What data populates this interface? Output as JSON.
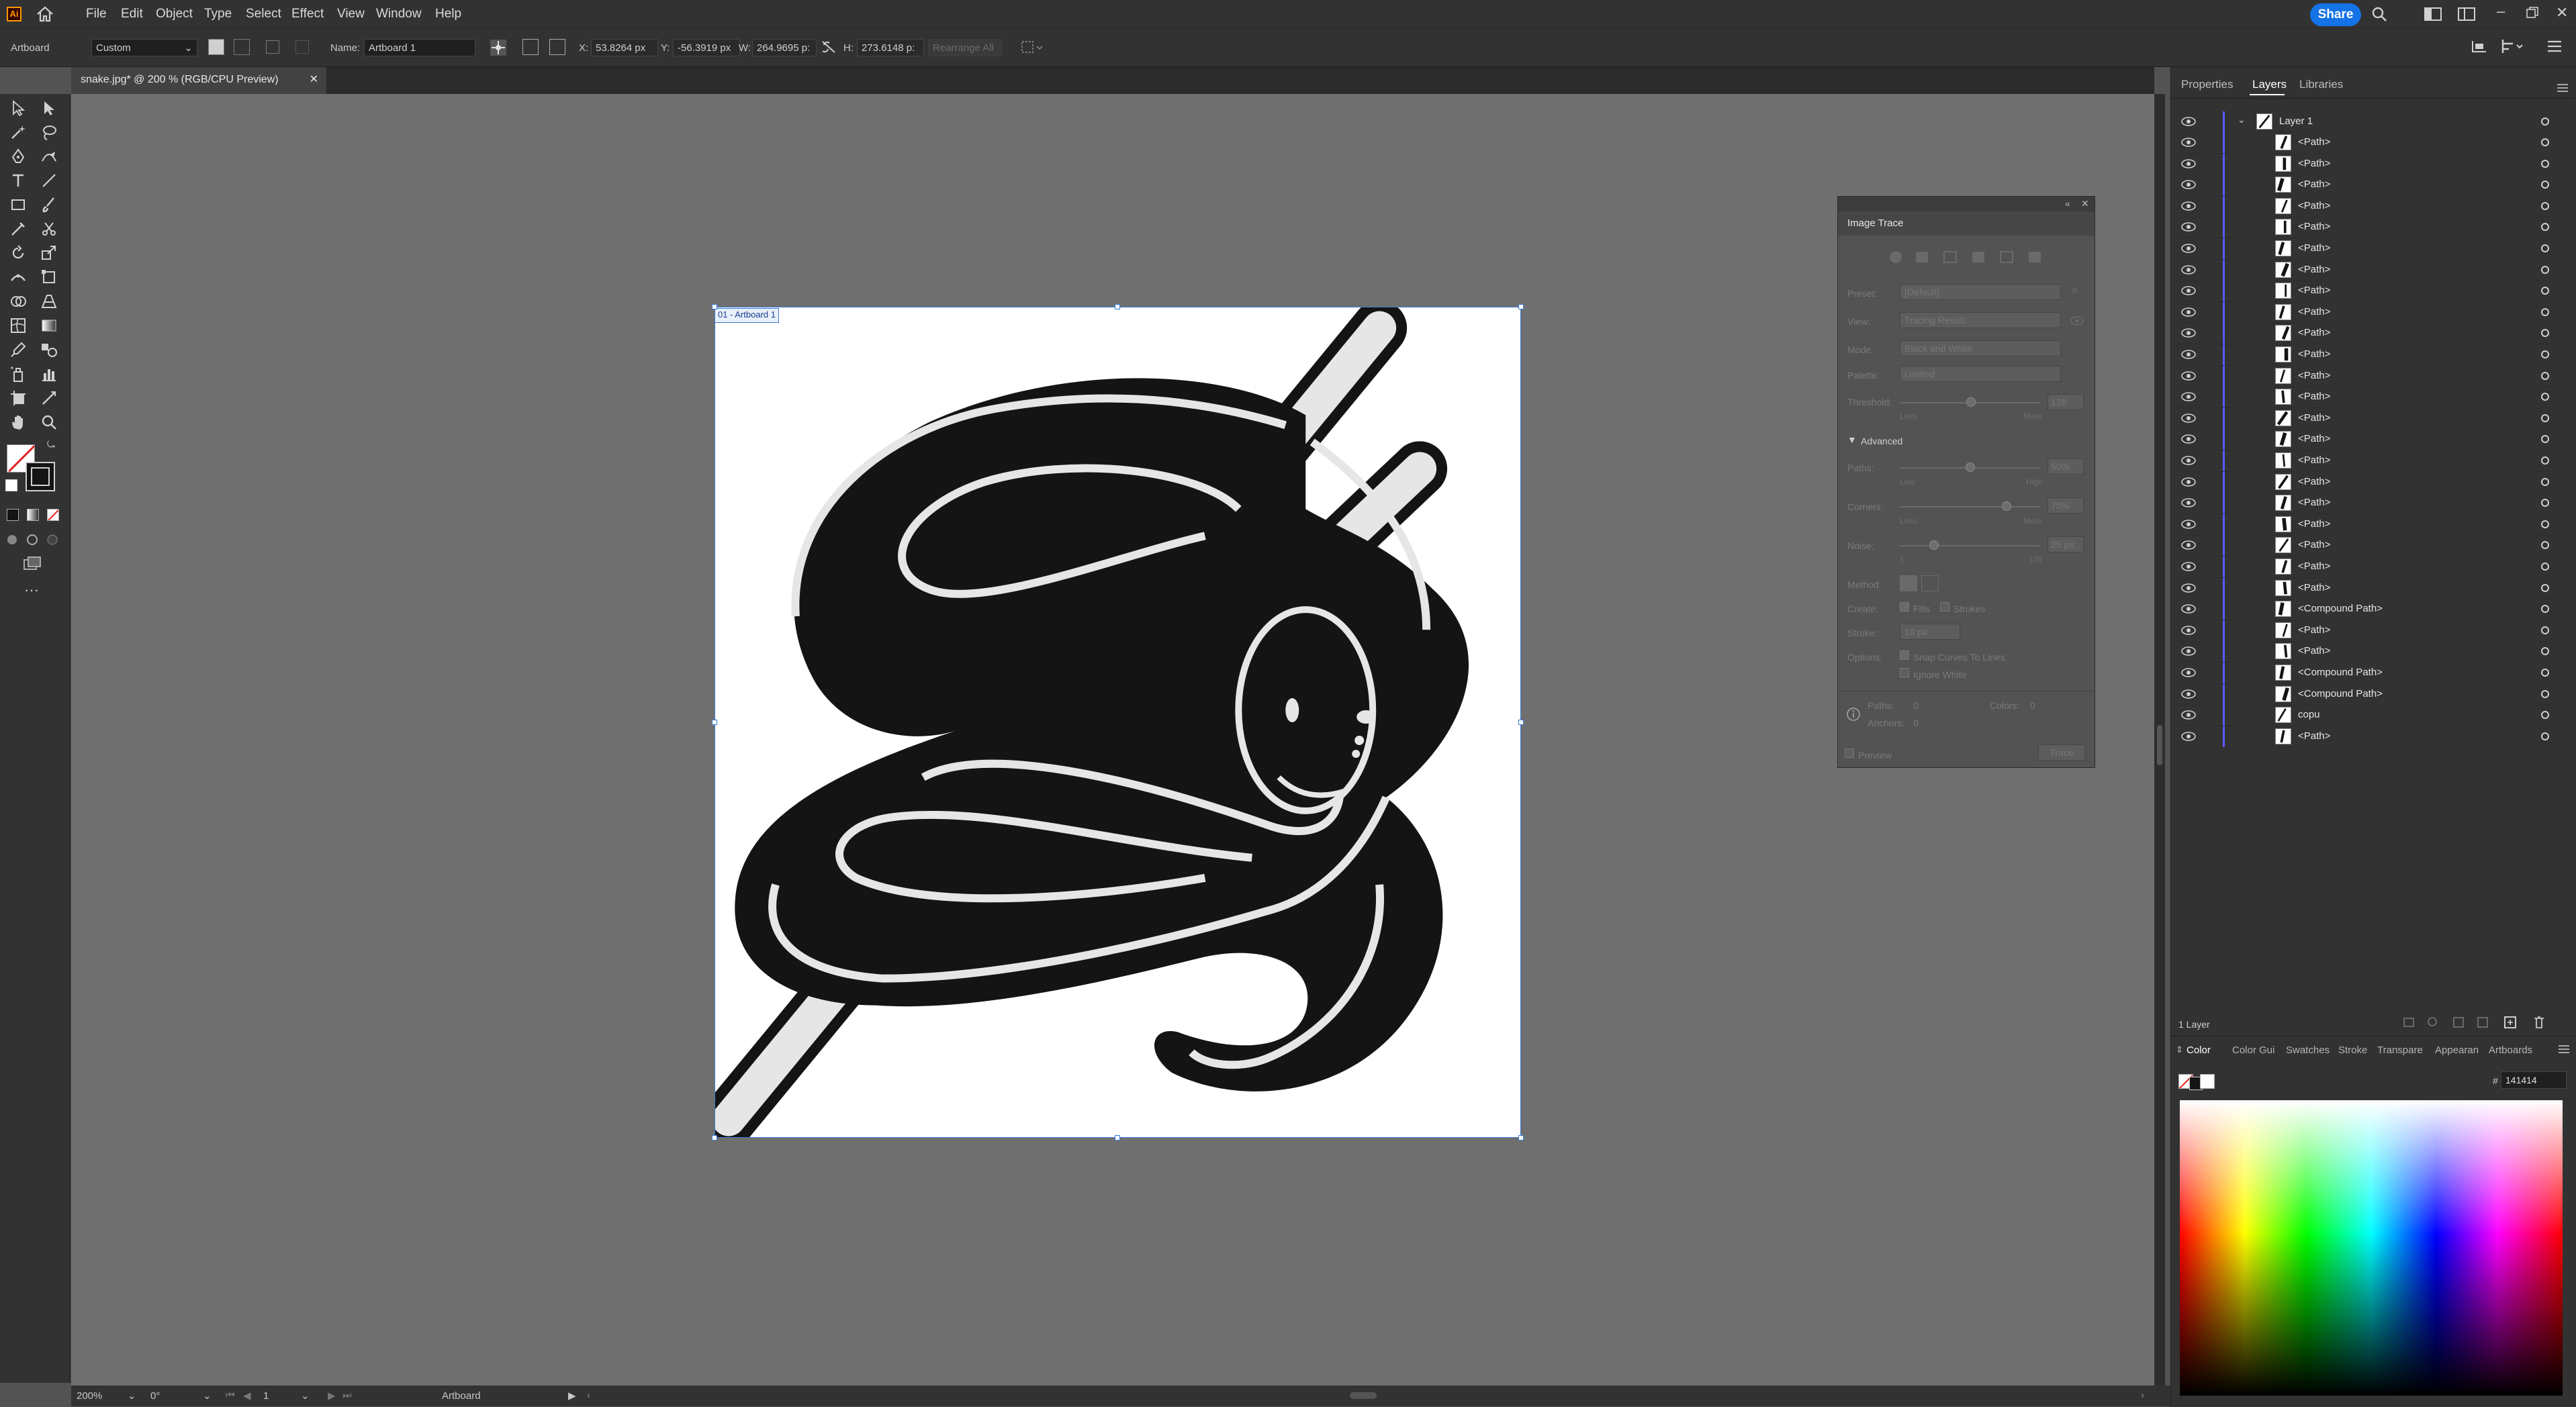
{
  "app": {
    "logo": "Ai",
    "menu": [
      "File",
      "Edit",
      "Object",
      "Type",
      "Select",
      "Effect",
      "View",
      "Window",
      "Help"
    ],
    "share_label": "Share"
  },
  "controlbar": {
    "artboard_label": "Artboard",
    "preset_value": "Custom",
    "name_label": "Name:",
    "name_value": "Artboard 1",
    "x_label": "X:",
    "x_value": "53.8264 px",
    "y_label": "Y:",
    "y_value": "-56.3919 px",
    "w_label": "W:",
    "w_value": "264.9695 p:",
    "h_label": "H:",
    "h_value": "273.6148 p:",
    "rearrange_label": "Rearrange All"
  },
  "document": {
    "tab_title": "snake.jpg* @ 200 % (RGB/CPU Preview)",
    "artboard_name": "01 - Artboard 1"
  },
  "image_trace": {
    "title": "Image Trace",
    "preset_label": "Preset:",
    "preset_value": "[Default]",
    "view_label": "View:",
    "view_value": "Tracing Result",
    "mode_label": "Mode:",
    "mode_value": "Black and White",
    "palette_label": "Palette:",
    "palette_value": "Limited",
    "threshold_label": "Threshold:",
    "threshold_value": "128",
    "less": "Less",
    "more": "More",
    "advanced_label": "Advanced",
    "paths_label": "Paths:",
    "paths_value": "50%",
    "low": "Low",
    "high": "High",
    "corners_label": "Corners:",
    "corners_value": "75%",
    "noise_label": "Noise:",
    "noise_value": "25 px",
    "noise_min": "1",
    "noise_max": "100",
    "method_label": "Method:",
    "create_label": "Create:",
    "fills_label": "Fills",
    "strokes_label": "Strokes",
    "stroke_label": "Stroke:",
    "stroke_value": "10 px",
    "options_label": "Options:",
    "snap_label": "Snap Curves To Lines",
    "ignore_white_label": "Ignore White",
    "paths_count_label": "Paths:",
    "paths_count": "0",
    "colors_count_label": "Colors:",
    "colors_count": "0",
    "anchors_label": "Anchors:",
    "anchors_count": "0",
    "preview_label": "Preview",
    "trace_label": "Trace"
  },
  "layers_panel": {
    "tabs": [
      "Properties",
      "Layers",
      "Libraries"
    ],
    "layer_name": "Layer 1",
    "items": [
      "<Path>",
      "<Path>",
      "<Path>",
      "<Path>",
      "<Path>",
      "<Path>",
      "<Path>",
      "<Path>",
      "<Path>",
      "<Path>",
      "<Path>",
      "<Path>",
      "<Path>",
      "<Path>",
      "<Path>",
      "<Path>",
      "<Path>",
      "<Path>",
      "<Path>",
      "<Path>",
      "<Path>",
      "<Path>",
      "<Compound Path>",
      "<Path>",
      "<Path>",
      "<Compound Path>",
      "<Compound Path>",
      "copu",
      "<Path>"
    ],
    "footer": "1 Layer"
  },
  "color_panel": {
    "tabs": [
      "Color",
      "Color Gui",
      "Swatches",
      "Stroke",
      "Transpare",
      "Appearan",
      "Artboards"
    ],
    "hash": "#",
    "hex_value": "141414"
  },
  "statusbar": {
    "zoom": "200%",
    "rotation": "0°",
    "artboard_number": "1",
    "mode": "Artboard"
  },
  "colors": {
    "accent": "#1473e6",
    "logo_orange": "#ff9a00",
    "layer_color": "#5a5aff",
    "snake_fill": "#141414"
  }
}
